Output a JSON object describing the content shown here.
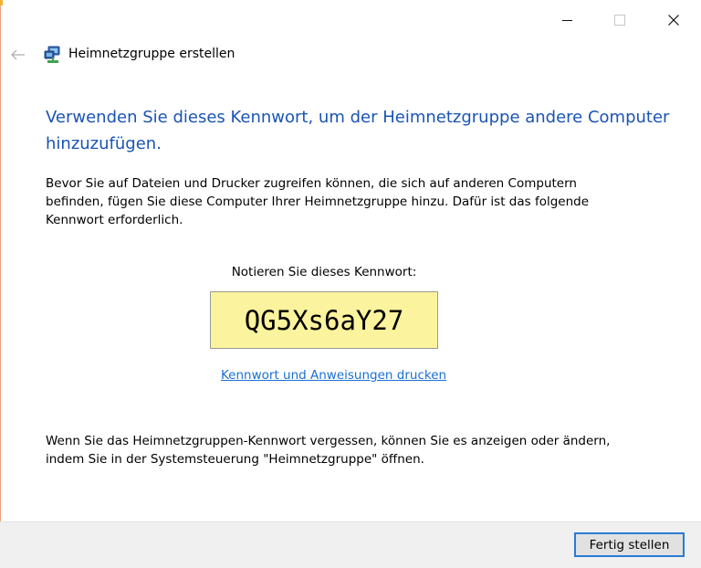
{
  "window": {
    "title": "Heimnetzgruppe erstellen"
  },
  "caption_buttons": {
    "minimize_icon": "minimize-icon",
    "maximize_icon": "maximize-icon",
    "close_icon": "close-icon"
  },
  "header": {
    "back_icon": "back-arrow-icon",
    "app_icon": "homegroup-icon"
  },
  "content": {
    "main_instruction": "Verwenden Sie dieses Kennwort, um der Heimnetzgruppe andere Computer hinzuzufügen.",
    "description": "Bevor Sie auf Dateien und Drucker zugreifen können, die sich auf anderen Computern befinden, fügen Sie diese Computer Ihrer Heimnetzgruppe hinzu. Dafür ist das folgende Kennwort erforderlich.",
    "password_label": "Notieren Sie dieses Kennwort:",
    "password": "QG5Xs6aY27",
    "print_link": "Kennwort und Anweisungen drucken",
    "footer_note": "Wenn Sie das Heimnetzgruppen-Kennwort vergessen, können Sie es anzeigen oder ändern, indem Sie in der Systemsteuerung \"Heimnetzgruppe\" öffnen."
  },
  "commands": {
    "finish_label": "Fertig stellen"
  },
  "colors": {
    "instruction": "#1a54b4",
    "link": "#1a6fd4",
    "password_box": "#fbf39d",
    "button_focus": "#2a7ad4",
    "command_area": "#f0f0f0"
  }
}
